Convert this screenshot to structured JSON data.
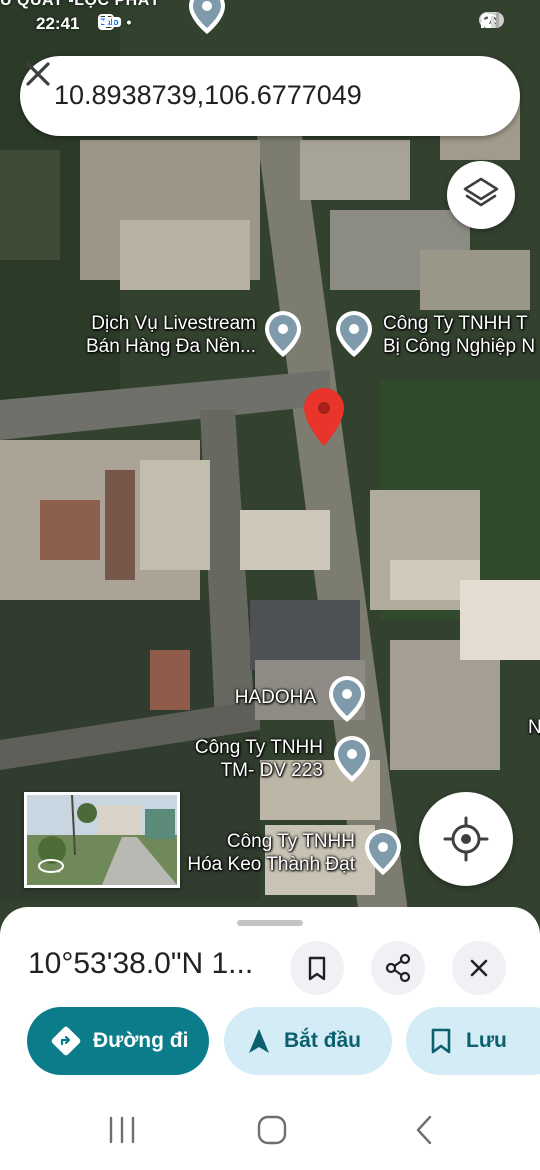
{
  "status_bar": {
    "carrier_banner": "U QUAY -LỘC PHÁT",
    "time": "22:41",
    "notif_zalo": "Zalo",
    "battery": "34"
  },
  "search": {
    "query": "10.8938739,106.6777049"
  },
  "map": {
    "places": [
      {
        "name_line1": "Dịch Vụ Livestream",
        "name_line2": "Bán Hàng Đa Nền..."
      },
      {
        "name_line1": "Công Ty TNHH T",
        "name_line2": "Bị Công Nghiệp N"
      },
      {
        "name_line1": "HADOHA",
        "name_line2": ""
      },
      {
        "name_line1": "Công Ty TNHH",
        "name_line2": "TM- DV 223"
      },
      {
        "name_line1": "Công Ty TNHH",
        "name_line2": "Hóa Keo Thành Đạt"
      }
    ],
    "edge_letter": "N",
    "colors": {
      "selected_pin": "#e8342a",
      "place_pin": "#7f9bab"
    }
  },
  "sheet": {
    "coordinate_title": "10°53'38.0\"N 1...",
    "directions_label": "Đường đi",
    "start_label": "Bắt đầu",
    "save_label": "Lưu",
    "colors": {
      "primary": "#0b7c8a",
      "secondary": "#d3ecf5"
    }
  },
  "icons": [
    "layers-icon",
    "close-icon",
    "my-location-icon",
    "bookmark-icon",
    "share-icon",
    "directions-icon",
    "navigation-arrow-icon",
    "recent-apps-icon",
    "home-icon",
    "back-icon"
  ]
}
